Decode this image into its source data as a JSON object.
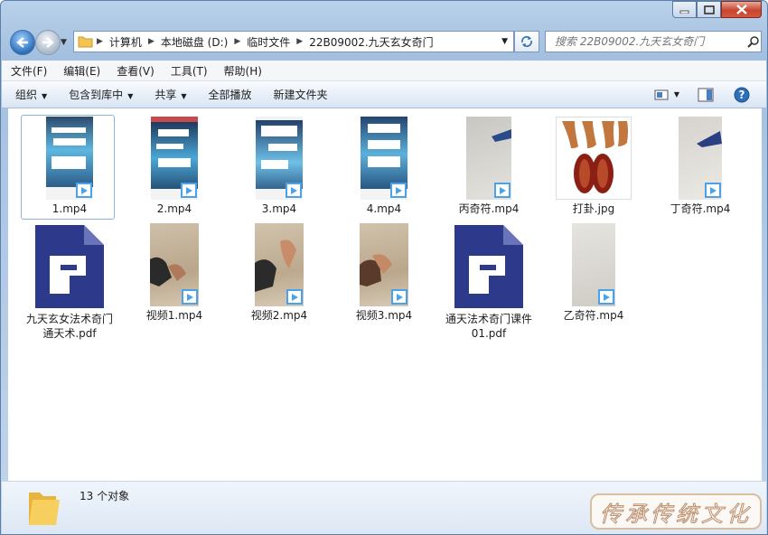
{
  "window": {
    "controls": {
      "minimize": "minimize",
      "maximize": "maximize",
      "close": "close"
    }
  },
  "address": {
    "segments": [
      "计算机",
      "本地磁盘 (D:)",
      "临时文件",
      "22B09002.九天玄女奇门"
    ]
  },
  "search": {
    "placeholder": "搜索 22B09002.九天玄女奇门"
  },
  "menu": [
    "文件(F)",
    "编辑(E)",
    "查看(V)",
    "工具(T)",
    "帮助(H)"
  ],
  "toolbar": {
    "organize": "组织",
    "include": "包含到库中",
    "share": "共享",
    "play_all": "全部播放",
    "new_folder": "新建文件夹"
  },
  "files": [
    {
      "name": "1.mp4",
      "type": "video",
      "thumb": "chat"
    },
    {
      "name": "2.mp4",
      "type": "video",
      "thumb": "chat"
    },
    {
      "name": "3.mp4",
      "type": "video",
      "thumb": "chat"
    },
    {
      "name": "4.mp4",
      "type": "video",
      "thumb": "chat"
    },
    {
      "name": "丙奇符.mp4",
      "type": "video",
      "thumb": "brush"
    },
    {
      "name": "打卦.jpg",
      "type": "image",
      "thumb": "divination"
    },
    {
      "name": "丁奇符.mp4",
      "type": "video",
      "thumb": "brush"
    },
    {
      "name": "九天玄女法术奇门通天术.pdf",
      "type": "pdf",
      "thumb": "pdf"
    },
    {
      "name": "视频1.mp4",
      "type": "video",
      "thumb": "floor"
    },
    {
      "name": "视频2.mp4",
      "type": "video",
      "thumb": "floor"
    },
    {
      "name": "视频3.mp4",
      "type": "video",
      "thumb": "floor"
    },
    {
      "name": "通天法术奇门课件01.pdf",
      "type": "pdf",
      "thumb": "pdf"
    },
    {
      "name": "乙奇符.mp4",
      "type": "video",
      "thumb": "paper"
    }
  ],
  "status": {
    "count": "13 个对象"
  },
  "watermark": "传承传统文化",
  "colors": {
    "accent": "#2d3a8c",
    "selection_border": "#8fb3db",
    "play_badge": "#4aa3ea"
  }
}
